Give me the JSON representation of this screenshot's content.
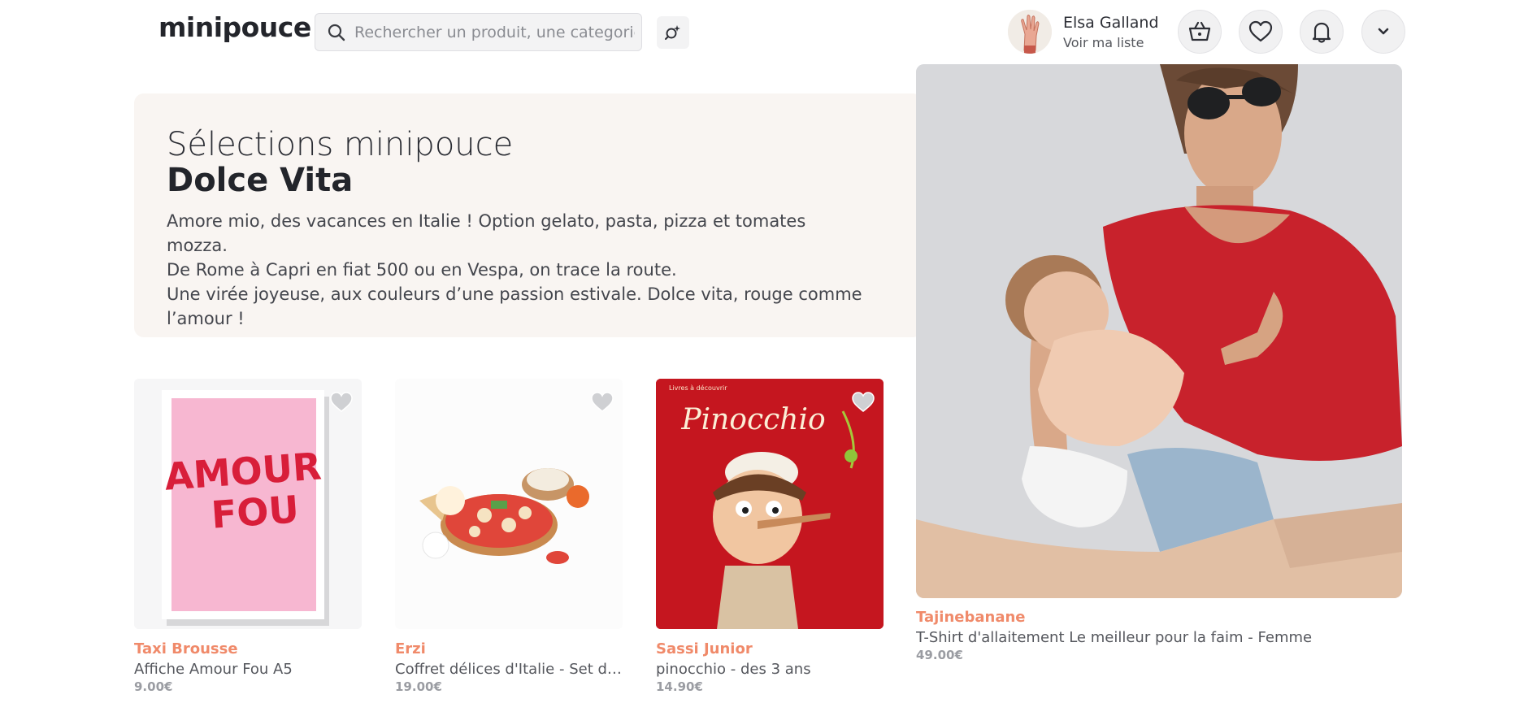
{
  "header": {
    "logo": "minipouce",
    "search_placeholder": "Rechercher un produit, une categorie, ...",
    "user_name": "Elsa Galland",
    "user_link": "Voir ma liste"
  },
  "hero": {
    "title": "Sélections minipouce",
    "subtitle": "Dolce Vita",
    "desc_lines": [
      "Amore mio, des vacances en Italie ! Option gelato, pasta, pizza et tomates mozza.",
      "De Rome à Capri en fiat 500 ou en Vespa, on trace la route.",
      "Une virée joyeuse, aux couleurs d’une passion estivale. Dolce vita, rouge comme",
      "l’amour !"
    ]
  },
  "poster_text": [
    "AMOUR",
    "FOU"
  ],
  "book_text": {
    "title": "Pinocchio",
    "corner_label": "Livres à découvrir"
  },
  "products": [
    {
      "brand": "Taxi Brousse",
      "name": "Affiche Amour Fou A5",
      "price": "9.00€"
    },
    {
      "brand": "Erzi",
      "name": "Coffret délices d'Italie - Set de ...",
      "price": "19.00€"
    },
    {
      "brand": "Sassi Junior",
      "name": "pinocchio - des 3 ans",
      "price": "14.90€"
    },
    {
      "brand": "Tajinebanane",
      "name": "T-Shirt d'allaitement Le meilleur pour la faim - Femme",
      "price": "49.00€"
    }
  ],
  "colors": {
    "brand": "#f08a6a",
    "hero_bg": "#f9f5f2",
    "text": "#2d2f36"
  },
  "icons": [
    "search-icon",
    "ai-search-icon",
    "basket-icon",
    "heart-icon",
    "bell-icon",
    "chevron-down-icon"
  ]
}
